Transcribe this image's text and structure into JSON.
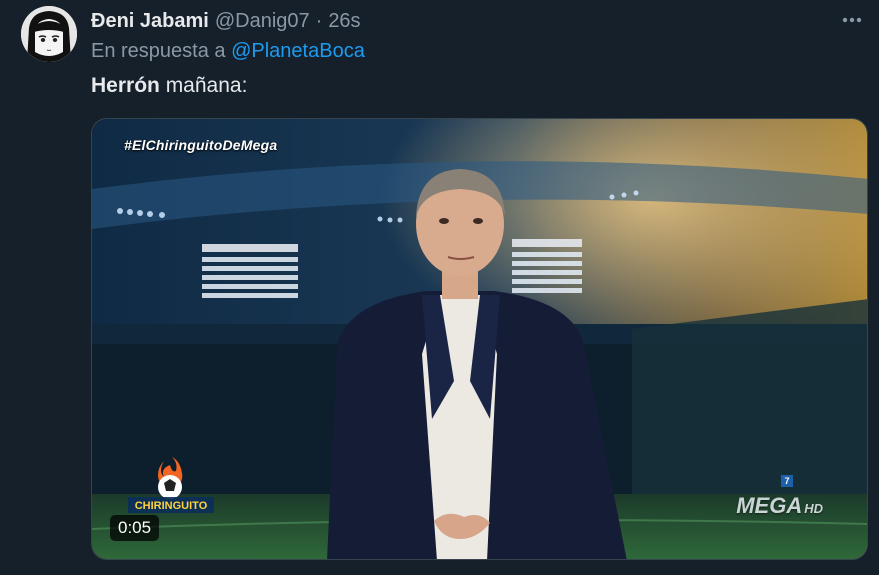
{
  "tweet": {
    "display_name": "Đeni Jabami",
    "handle": "@Danig07",
    "separator": "·",
    "time": "26s",
    "reply_prefix": "En respuesta a",
    "reply_mention": "@PlanetaBoca",
    "text_bold": "Herrón",
    "text_rest": " mañana:",
    "more_icon": "more-horizontal-icon"
  },
  "video": {
    "hashtag": "#ElChiringuitoDeMega",
    "watermark": "MEGA",
    "watermark_suffix": "HD",
    "channel_number": "7",
    "logo_text": "CHIRINGUITO",
    "duration": "0:05"
  },
  "colors": {
    "background": "#15202b",
    "primary_text": "#e7e9ea",
    "secondary_text": "#8b98a5",
    "link": "#1d9bf0"
  }
}
